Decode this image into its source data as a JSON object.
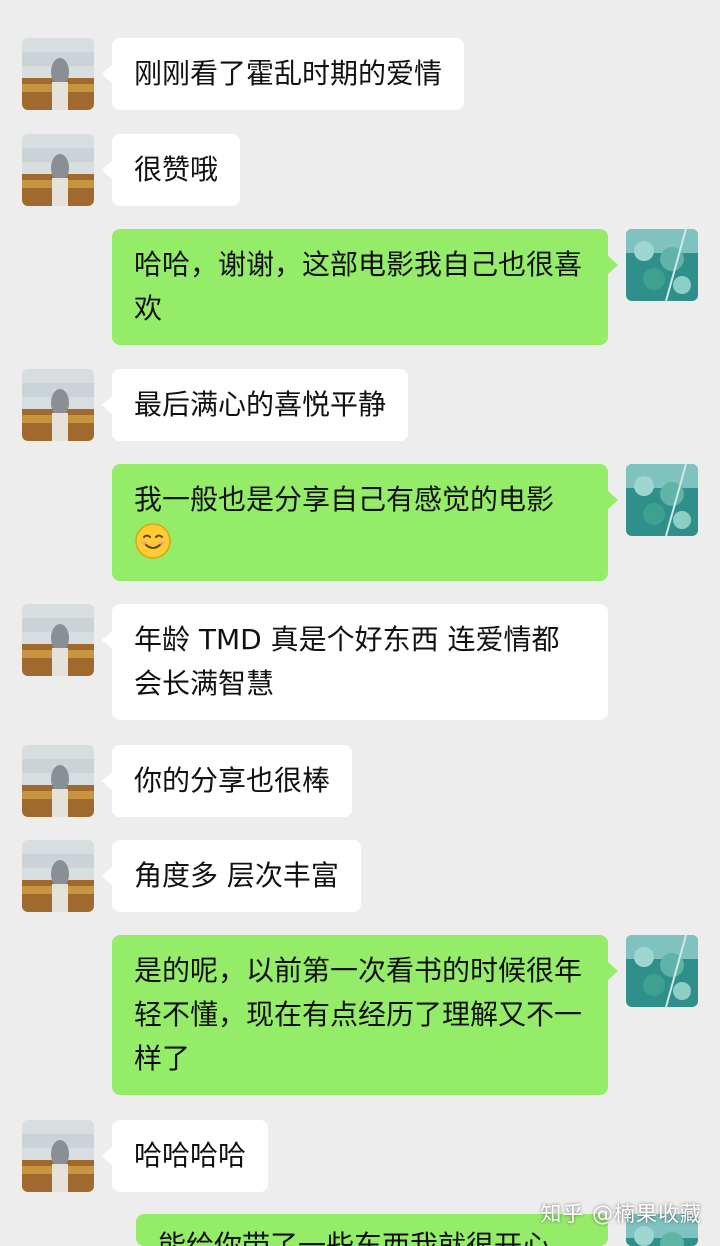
{
  "chat": {
    "colors": {
      "background": "#ededed",
      "incoming_bubble": "#ffffff",
      "outgoing_bubble": "#95ec69"
    },
    "incoming_avatar_icon": "landscape-photo-avatar",
    "outgoing_avatar_icon": "teal-foliage-avatar",
    "messages": [
      {
        "direction": "in",
        "text": "刚刚看了霍乱时期的爱情"
      },
      {
        "direction": "in",
        "text": "很赞哦"
      },
      {
        "direction": "out",
        "text": "哈哈，谢谢，这部电影我自己也很喜欢"
      },
      {
        "direction": "in",
        "text": "最后满心的喜悦平静"
      },
      {
        "direction": "out",
        "text": "我一般也是分享自己有感觉的电影",
        "emoji": "smiling-face-emoji"
      },
      {
        "direction": "in",
        "text": "年龄 TMD 真是个好东西 连爱情都会长满智慧"
      },
      {
        "direction": "in",
        "text": "你的分享也很棒"
      },
      {
        "direction": "in",
        "text": "角度多 层次丰富"
      },
      {
        "direction": "out",
        "text": "是的呢，以前第一次看书的时候很年轻不懂，现在有点经历了理解又不一样了"
      },
      {
        "direction": "in",
        "text": "哈哈哈哈"
      },
      {
        "direction": "out",
        "text": "能给你带了一些东西我就很开心"
      }
    ]
  },
  "watermark": {
    "text": "知乎 @楠果收藏"
  }
}
